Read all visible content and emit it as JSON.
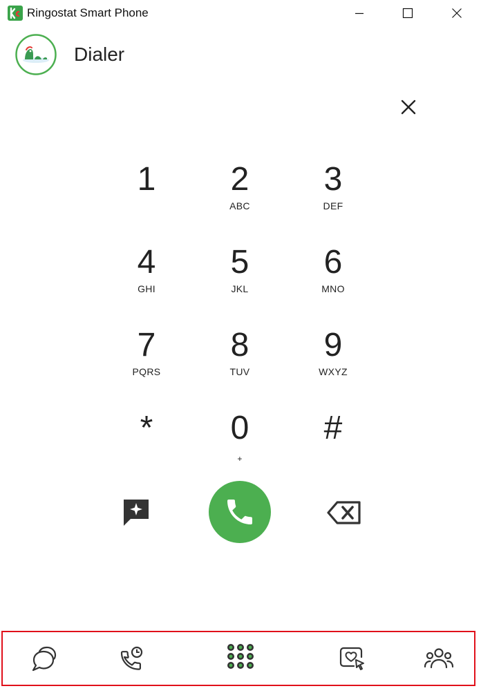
{
  "window": {
    "title": "Ringostat Smart Phone",
    "controls": [
      "minimize-icon",
      "maximize-icon",
      "close-icon"
    ]
  },
  "header": {
    "title": "Dialer",
    "avatar_icon": "avatar-logo"
  },
  "dialer": {
    "clear_icon": "close-icon",
    "keys": [
      {
        "digit": "1",
        "letters": ""
      },
      {
        "digit": "2",
        "letters": "ABC"
      },
      {
        "digit": "3",
        "letters": "DEF"
      },
      {
        "digit": "4",
        "letters": "GHI"
      },
      {
        "digit": "5",
        "letters": "JKL"
      },
      {
        "digit": "6",
        "letters": "MNO"
      },
      {
        "digit": "7",
        "letters": "PQRS"
      },
      {
        "digit": "8",
        "letters": "TUV"
      },
      {
        "digit": "9",
        "letters": "WXYZ"
      },
      {
        "digit": "*",
        "letters": ""
      },
      {
        "digit": "0",
        "letters": "+"
      },
      {
        "digit": "#",
        "letters": ""
      }
    ],
    "actions": {
      "sms_icon": "message-sparkle-icon",
      "call_icon": "phone-icon",
      "backspace_icon": "backspace-icon"
    }
  },
  "bottom_nav": {
    "items": [
      {
        "name": "chats",
        "icon": "chat-bubbles-icon"
      },
      {
        "name": "call-history",
        "icon": "phone-clock-icon"
      },
      {
        "name": "dialer",
        "icon": "keypad-icon",
        "active": true
      },
      {
        "name": "visitors",
        "icon": "heart-cursor-icon"
      },
      {
        "name": "contacts",
        "icon": "people-icon"
      }
    ]
  },
  "colors": {
    "accent": "#4caf50",
    "highlight_border": "#e0101a",
    "text": "#222222"
  }
}
